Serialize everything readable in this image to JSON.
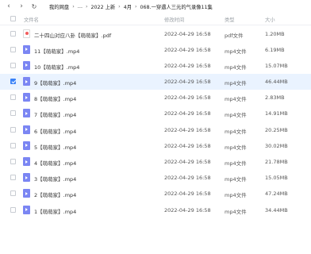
{
  "nav": {
    "back_icon": "‹",
    "forward_icon": "›",
    "refresh_icon": "↻"
  },
  "breadcrumb": {
    "separator": "›",
    "items": [
      "我的网盘",
      "…",
      "2022 上新",
      "4月",
      "068.一穿遇人三元的气录像11集"
    ]
  },
  "table": {
    "columns": {
      "name": "文件名",
      "time": "修改时间",
      "type": "类型",
      "size": "大小"
    },
    "rows": [
      {
        "name": "二十四山对应八卦【萌萌家】.pdf",
        "time": "2022-04-29 16:58",
        "type": "pdf文件",
        "size": "1.20MB",
        "icon": "pdf-file-icon",
        "selected": false
      },
      {
        "name": "11【萌萌家】.mp4",
        "time": "2022-04-29 16:58",
        "type": "mp4文件",
        "size": "6.19MB",
        "icon": "video-file-icon",
        "selected": false
      },
      {
        "name": "10【萌萌家】.mp4",
        "time": "2022-04-29 16:58",
        "type": "mp4文件",
        "size": "15.07MB",
        "icon": "video-file-icon",
        "selected": false
      },
      {
        "name": "9【萌萌家】.mp4",
        "time": "2022-04-29 16:58",
        "type": "mp4文件",
        "size": "46.44MB",
        "icon": "video-file-icon",
        "selected": true
      },
      {
        "name": "8【萌萌家】.mp4",
        "time": "2022-04-29 16:58",
        "type": "mp4文件",
        "size": "2.83MB",
        "icon": "video-file-icon",
        "selected": false
      },
      {
        "name": "7【萌萌家】.mp4",
        "time": "2022-04-29 16:58",
        "type": "mp4文件",
        "size": "14.91MB",
        "icon": "video-file-icon",
        "selected": false
      },
      {
        "name": "6【萌萌家】.mp4",
        "time": "2022-04-29 16:58",
        "type": "mp4文件",
        "size": "20.25MB",
        "icon": "video-file-icon",
        "selected": false
      },
      {
        "name": "5【萌萌家】.mp4",
        "time": "2022-04-29 16:58",
        "type": "mp4文件",
        "size": "30.02MB",
        "icon": "video-file-icon",
        "selected": false
      },
      {
        "name": "4【萌萌家】.mp4",
        "time": "2022-04-29 16:58",
        "type": "mp4文件",
        "size": "21.78MB",
        "icon": "video-file-icon",
        "selected": false
      },
      {
        "name": "3【萌萌家】.mp4",
        "time": "2022-04-29 16:58",
        "type": "mp4文件",
        "size": "15.05MB",
        "icon": "video-file-icon",
        "selected": false
      },
      {
        "name": "2【萌萌家】.mp4",
        "time": "2022-04-29 16:58",
        "type": "mp4文件",
        "size": "47.24MB",
        "icon": "video-file-icon",
        "selected": false
      },
      {
        "name": "1【萌萌家】.mp4",
        "time": "2022-04-29 16:58",
        "type": "mp4文件",
        "size": "34.44MB",
        "icon": "video-file-icon",
        "selected": false
      }
    ]
  },
  "colors": {
    "selected_row_bg": "#eaf3ff",
    "checkbox_checked": "#3a82f7",
    "video_icon": "#7b86f3",
    "pdf_accent": "#f25c5c"
  }
}
